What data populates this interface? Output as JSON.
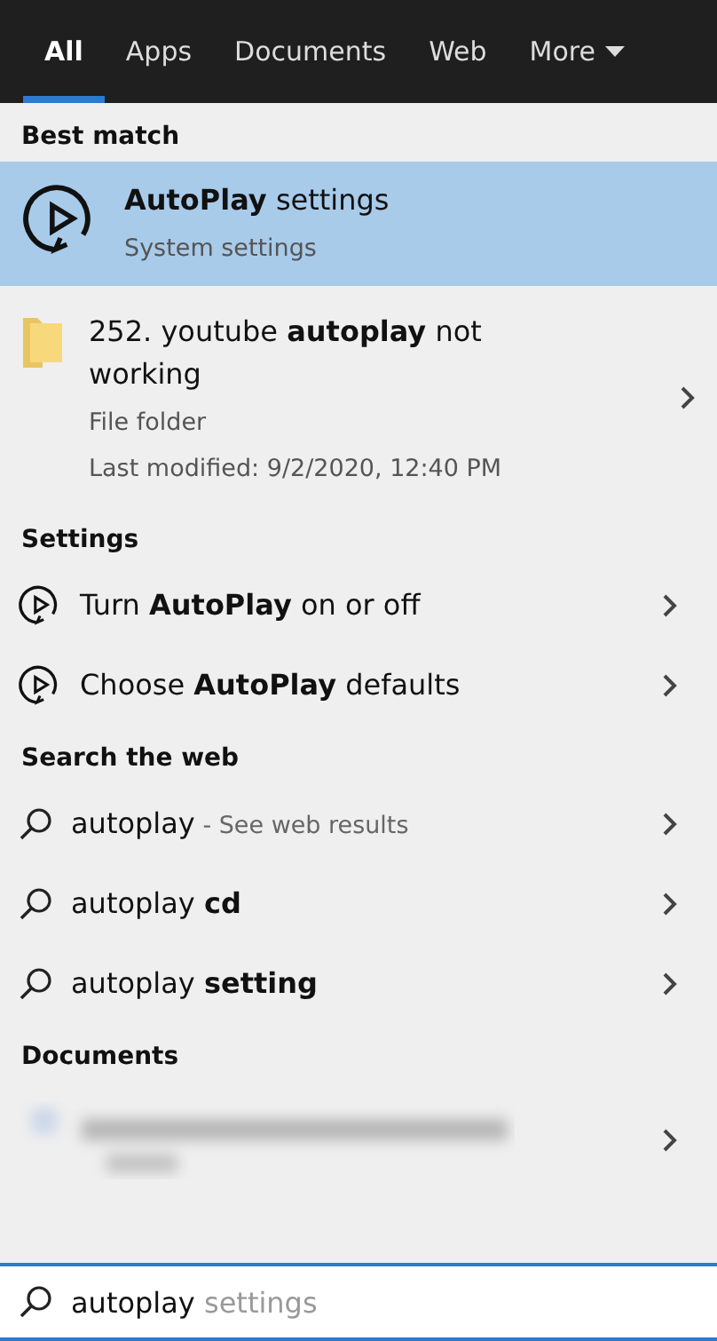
{
  "tabs": [
    {
      "label": "All",
      "selected": true
    },
    {
      "label": "Apps",
      "selected": false
    },
    {
      "label": "Documents",
      "selected": false
    },
    {
      "label": "Web",
      "selected": false
    },
    {
      "label": "More",
      "selected": false,
      "dropdown": true
    }
  ],
  "best_match": {
    "heading": "Best match",
    "items": [
      {
        "kind": "setting",
        "title": "**AutoPlay** settings",
        "subtitle": "System settings",
        "selected": true
      },
      {
        "kind": "folder",
        "title": "252. youtube **autoplay** not working",
        "subtitle": "File folder",
        "detail": "Last modified: 9/2/2020, 12:40 PM",
        "selected": false
      }
    ]
  },
  "sections": [
    {
      "heading": "Settings",
      "items": [
        {
          "kind": "setting",
          "text": "Turn **AutoPlay** on or off"
        },
        {
          "kind": "setting",
          "text": "Choose **AutoPlay** defaults"
        }
      ]
    },
    {
      "heading": "Search the web",
      "items": [
        {
          "kind": "web",
          "text": "autoplay",
          "hint": "- See web results"
        },
        {
          "kind": "web",
          "text": "autoplay **cd**"
        },
        {
          "kind": "web",
          "text": "autoplay **setting**"
        }
      ]
    },
    {
      "heading": "Documents",
      "items": [
        {
          "kind": "blurred"
        }
      ]
    }
  ],
  "search": {
    "value": "autoplay",
    "suggestion": "settings"
  }
}
